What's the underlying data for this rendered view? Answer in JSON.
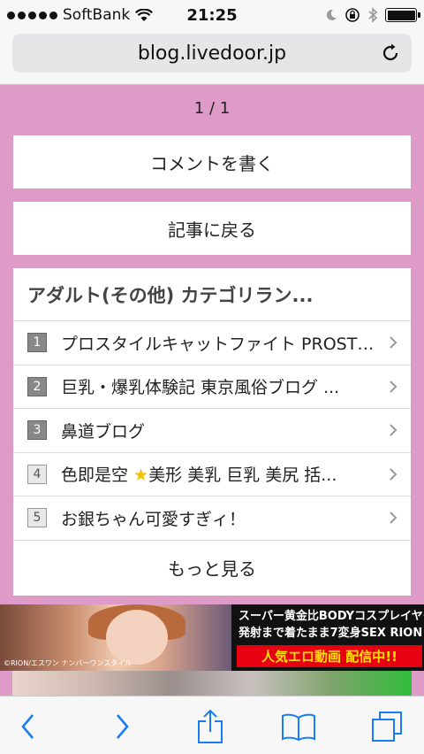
{
  "status_bar": {
    "carrier": "SoftBank",
    "time": "21:25",
    "accent": "#111111"
  },
  "browser": {
    "url": "blog.livedoor.jp"
  },
  "content": {
    "pager": "1 / 1",
    "comment_button": "コメントを書く",
    "back_button": "記事に戻る",
    "ranking": {
      "title": "アダルト(その他) カテゴリラン...",
      "items": [
        {
          "rank": "1",
          "title": "プロスタイルキャットファイト PROSTYLE CATFIGHT"
        },
        {
          "rank": "2",
          "title": "巨乳・爆乳体験記 東京風俗ブログ ..."
        },
        {
          "rank": "3",
          "title": "鼻道ブログ"
        },
        {
          "rank": "4",
          "title_before_star": "色即是空 ",
          "title_after_star": "美形 美乳 巨乳 美尻 括..."
        },
        {
          "rank": "5",
          "title": "お銀ちゃん可愛すぎィ！"
        }
      ],
      "more": "もっと見る"
    }
  },
  "ad": {
    "line1": "スーパー黄金比BODYコスプレイヤー",
    "line2": "発射まで着たまま7変身SEX RION",
    "cta": "人気エロ動画 配信中!!",
    "credit": "©RION/エスワン ナンバーワンスタイル"
  },
  "colors": {
    "page_background": "#df9bc8",
    "ios_blue": "#1a7cf4",
    "ad_red": "#e60012",
    "ad_yellow": "#ffe100"
  },
  "icons": {
    "back": "chevron-left-icon",
    "forward": "chevron-right-icon",
    "share": "share-icon",
    "bookmarks": "book-icon",
    "tabs": "tabs-icon",
    "reload": "reload-icon"
  }
}
